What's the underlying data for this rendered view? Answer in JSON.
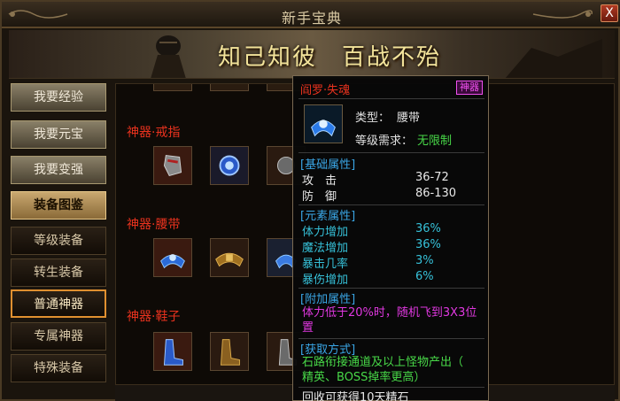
{
  "window": {
    "title": "新手宝典",
    "close_label": "X"
  },
  "banner": {
    "slogan": "知己知彼　百战不殆"
  },
  "sidebar": {
    "items": [
      {
        "label": "我要经验"
      },
      {
        "label": "我要元宝"
      },
      {
        "label": "我要变强"
      },
      {
        "label": "装备图鉴"
      },
      {
        "label": "等级装备"
      },
      {
        "label": "转生装备"
      },
      {
        "label": "普通神器"
      },
      {
        "label": "专属神器"
      },
      {
        "label": "特殊装备"
      }
    ]
  },
  "content": {
    "categories": [
      {
        "label": "神器·戒指"
      },
      {
        "label": "神器·腰带"
      },
      {
        "label": "神器·鞋子"
      }
    ]
  },
  "tooltip": {
    "name": "阎罗·失魂",
    "badge": "神器",
    "type_label": "类型：",
    "type_value": "腰带",
    "level_label": "等级需求：",
    "level_value": "无限制",
    "base_section": "[基础属性]",
    "attack_label": "攻　击",
    "attack_value": "36-72",
    "defense_label": "防　御",
    "defense_value": "86-130",
    "element_section": "[元素属性]",
    "elements": [
      {
        "key": "体力增加",
        "value": "36%"
      },
      {
        "key": "魔法增加",
        "value": "36%"
      },
      {
        "key": "暴击几率",
        "value": "3%"
      },
      {
        "key": "暴伤增加",
        "value": "6%"
      }
    ],
    "extra_section": "[附加属性]",
    "extra_line1": "体力低于20%时，随机飞到3X3位",
    "extra_line2": "置",
    "source_section": "[获取方式]",
    "source_line1": "石路衔接通道及以上怪物产出（",
    "source_line2": "精英、BOSS掉率更高）",
    "recycle_text": "回收可获得10天精石"
  },
  "colors": {
    "category_red": "#e8321e",
    "section_blue": "#3aa6e6",
    "element_cyan": "#36c0d8",
    "extra_pink": "#e038e0",
    "source_green": "#48d848",
    "slogan_gold": "#f3e39a"
  },
  "icons": {
    "close": "close-icon",
    "ring_items": [
      "ring-gauntlet-icon",
      "ring-orb-icon",
      "ring-partial-icon"
    ],
    "belt_items": [
      "belt-blue-icon",
      "belt-gold-icon",
      "belt-partial-icon"
    ],
    "boot_items": [
      "boots-blue-icon",
      "boots-gold-icon",
      "boots-partial-icon"
    ],
    "tooltip_item": "belt-blue-icon"
  }
}
